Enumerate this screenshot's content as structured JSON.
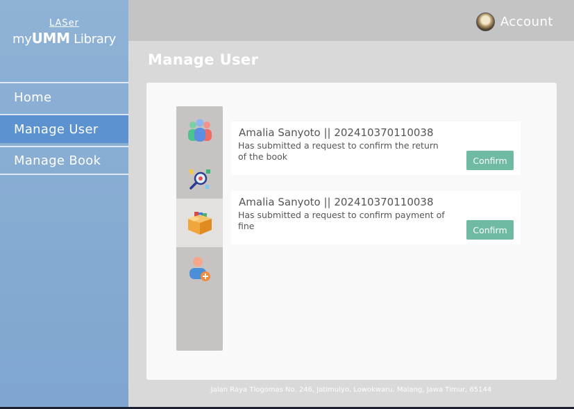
{
  "sidebar": {
    "logo_top": "LASer",
    "logo_app_prefix": "my",
    "logo_app_bold": "UMM",
    "logo_app_suffix": " Library",
    "items": [
      {
        "label": "Home",
        "active": false
      },
      {
        "label": "Manage User",
        "active": true
      },
      {
        "label": "Manage Book",
        "active": false
      }
    ]
  },
  "header": {
    "account_label": "Account"
  },
  "main": {
    "title": "Manage User",
    "icons": [
      "users-group-icon",
      "search-magnifier-icon",
      "book-box-icon",
      "add-user-icon"
    ],
    "requests": [
      {
        "name": "Amalia Sanyoto || 202410370110038",
        "message": "Has submitted a request to confirm the return of the book",
        "action": "Confirm"
      },
      {
        "name": "Amalia Sanyoto || 202410370110038",
        "message": "Has submitted a request to confirm payment of fine",
        "action": "Confirm"
      }
    ]
  },
  "footer": {
    "address": "Jalan Raya Tlogomas No. 246, Jatimulyo, Lowokwaru, Malang, Jawa Timur, 65144"
  },
  "colors": {
    "sidebar": "#7fa6cf",
    "active_nav": "#5b92cf",
    "confirm_button": "#6fbaa3",
    "topbar": "#c4c4c4"
  }
}
